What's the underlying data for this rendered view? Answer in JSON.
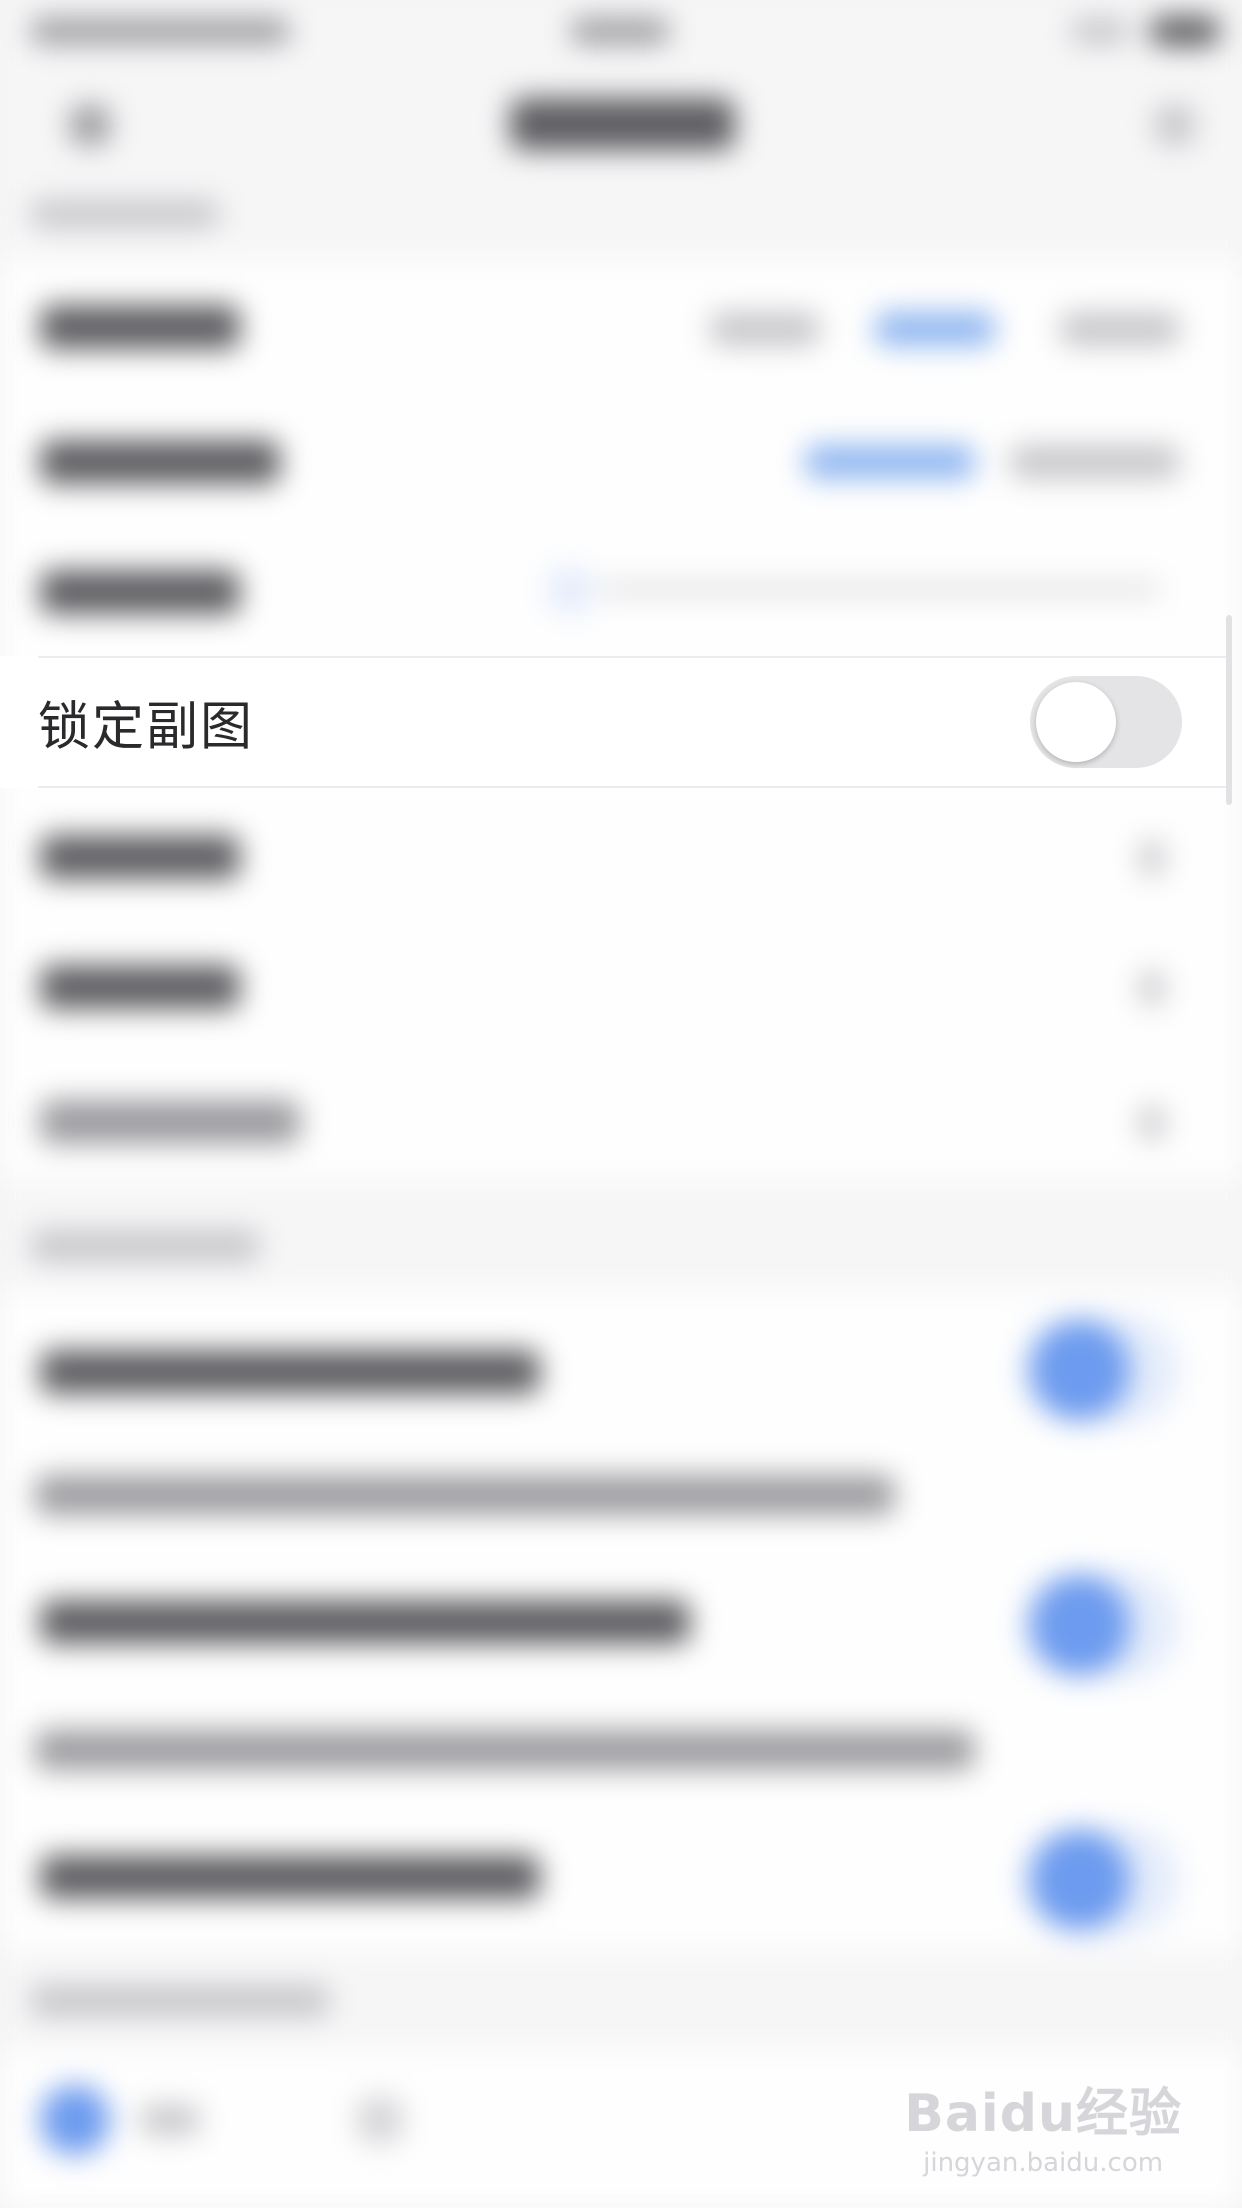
{
  "setting_row": {
    "label": "锁定副图",
    "toggle_state": "off"
  },
  "watermark": {
    "brand": "Baidu经验",
    "url": "jingyan.baidu.com"
  },
  "colors": {
    "toggle_track_off": "#e4e4e6",
    "toggle_knob": "#ffffff",
    "accent_blue": "#6d9bef",
    "row_background": "#ffffff",
    "page_background": "#f4f4f5"
  }
}
